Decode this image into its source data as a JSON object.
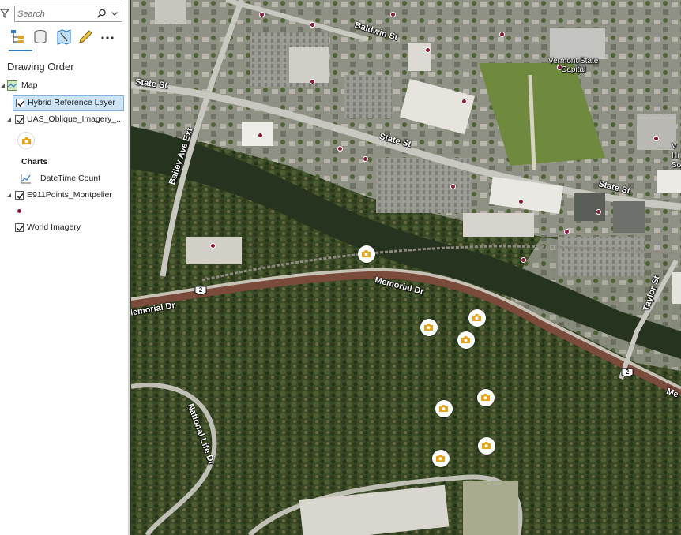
{
  "contents_pane": {
    "search": {
      "placeholder": "Search",
      "value": ""
    },
    "toolbar": [
      "list-by-drawing-order",
      "list-by-data-source",
      "list-by-selection",
      "list-by-editing",
      "more-options"
    ],
    "heading": "Drawing Order",
    "map_item": "Map",
    "layers": [
      {
        "name": "Hybrid Reference Layer",
        "checked": true,
        "selected": true
      },
      {
        "name": "UAS_Oblique_Imagery_...",
        "checked": true,
        "expanded": true,
        "symbol": "camera-icon"
      },
      {
        "name": "E911Points_Montpelier",
        "checked": true,
        "expanded": true,
        "symbol": "point-symbol"
      },
      {
        "name": "World Imagery",
        "checked": true
      }
    ],
    "charts_heading": "Charts",
    "chart_item": "DateTime Count",
    "colors": {
      "selected_row": "#cde4f7",
      "accent": "#2f7dc6",
      "camera": "#e8a317",
      "point": "#8a1a3c"
    }
  },
  "map": {
    "labels": {
      "baldwin": "Baldwin St",
      "state_left": "State St",
      "state_mid": "State St",
      "state_right": "State St",
      "bailey": "Bailey Ave Ext",
      "memorial_left": "Memorial Dr",
      "memorial_mid": "Memorial Dr",
      "memorial_right": "Me",
      "taylor": "Taylor St",
      "national_life": "National Life Dr",
      "capitol": "Vermont State\nCapital",
      "edge_label": "V\nHi\nSoci"
    },
    "shields": {
      "route_a": "2",
      "route_b": "2"
    },
    "markers": "camera-icon"
  }
}
